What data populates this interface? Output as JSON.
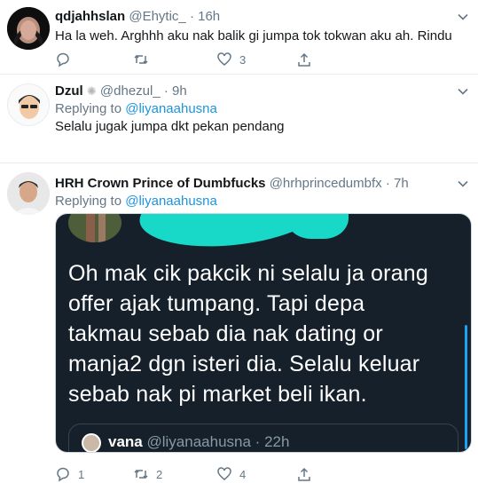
{
  "tweets": [
    {
      "name": "qdjahhslan",
      "handle": "@Ehytic_",
      "time": "16h",
      "text": "Ha la weh. Arghhh aku nak balik gi jumpa tok tokwan aku ah. Rindu",
      "counts": {
        "reply": "",
        "retweet": "",
        "like": "3"
      }
    },
    {
      "name": "Dzul",
      "handle": "@dhezul_",
      "time": "9h",
      "replying_label": "Replying to",
      "replying_handle": "@liyanaahusna",
      "text": "Selalu jugak jumpa dkt pekan pendang"
    },
    {
      "name": "HRH Crown Prince of Dumbfucks",
      "handle": "@hrhprincedumbfx",
      "time": "7h",
      "replying_label": "Replying to",
      "replying_handle": "@liyanaahusna",
      "image_text": "Oh mak cik pakcik ni selalu ja orang\noffer ajak tumpang. Tapi depa\ntakmau sebab dia nak dating or\nmanja2 dgn isteri dia. Selalu keluar\nsebab nak pi market beli ikan.",
      "quote_name": "vana",
      "quote_handle": "@liyanaahusna",
      "quote_time": "22h",
      "counts": {
        "reply": "1",
        "retweet": "2",
        "like": "4"
      }
    }
  ],
  "colors": {
    "link": "#1b95e0",
    "muted": "#657786",
    "dark_card": "#15202b",
    "accent_blob": "#18d9c8"
  }
}
